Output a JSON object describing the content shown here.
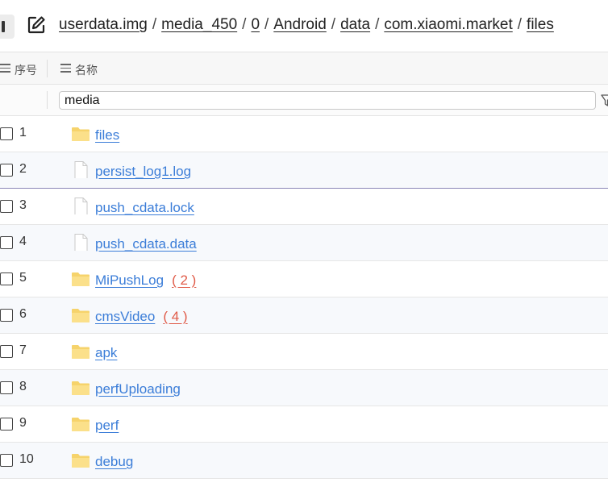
{
  "breadcrumb": [
    "userdata.img",
    "media_450",
    "0",
    "Android",
    "data",
    "com.xiaomi.market",
    "files"
  ],
  "breadcrumb_separator": "/",
  "columns": {
    "index": "序号",
    "name": "名称"
  },
  "filter": {
    "value": "media"
  },
  "colors": {
    "link": "#3b7dd8",
    "count": "#e05a47",
    "folder": "#f6d36b"
  },
  "rows": [
    {
      "index": "1",
      "type": "folder",
      "icon": "folder-icon",
      "name": "files",
      "count": ""
    },
    {
      "index": "2",
      "type": "file",
      "icon": "file-icon",
      "name": "persist_log1.log",
      "count": ""
    },
    {
      "index": "3",
      "type": "file",
      "icon": "file-icon",
      "name": "push_cdata.lock",
      "count": ""
    },
    {
      "index": "4",
      "type": "file",
      "icon": "file-icon",
      "name": "push_cdata.data",
      "count": ""
    },
    {
      "index": "5",
      "type": "folder",
      "icon": "folder-icon",
      "name": "MiPushLog",
      "count": "( 2 )"
    },
    {
      "index": "6",
      "type": "folder",
      "icon": "folder-icon",
      "name": "cmsVideo",
      "count": "( 4 )"
    },
    {
      "index": "7",
      "type": "folder",
      "icon": "folder-icon",
      "name": "apk",
      "count": ""
    },
    {
      "index": "8",
      "type": "folder",
      "icon": "folder-icon",
      "name": "perfUploading",
      "count": ""
    },
    {
      "index": "9",
      "type": "folder",
      "icon": "folder-icon",
      "name": "perf",
      "count": ""
    },
    {
      "index": "10",
      "type": "folder",
      "icon": "folder-icon",
      "name": "debug",
      "count": ""
    }
  ]
}
